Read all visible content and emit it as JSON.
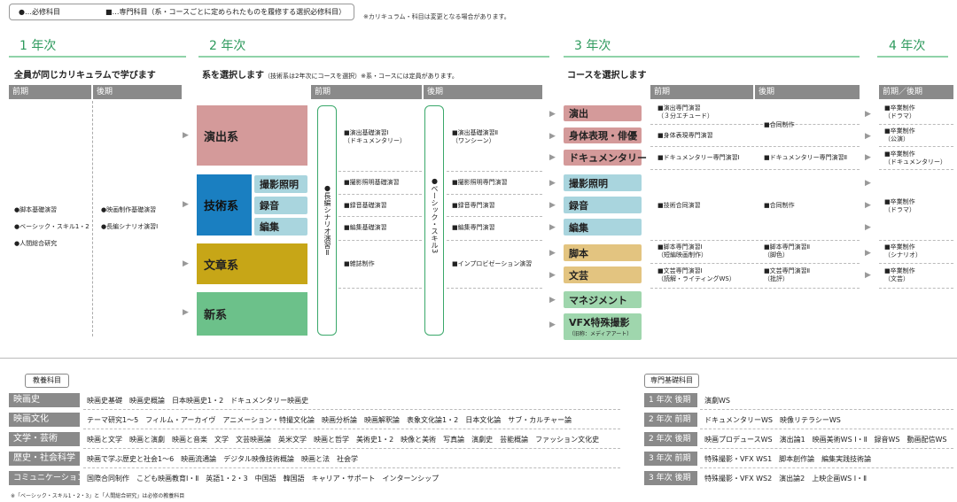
{
  "legend": {
    "required": "●…必修科目",
    "major": "■…専門科目（系・コースごとに定められたものを履修する選択必修科目）"
  },
  "notice": "※カリキュラム・科目は変更となる場合があります。",
  "years": {
    "y1": "1 年次",
    "y2": "2 年次",
    "y3": "3 年次",
    "y4": "4 年次"
  },
  "headings": {
    "h1": "全員が同じカリキュラムで学びます",
    "h2": "系を選択します",
    "h2_note": "（技術系は2年次にコースを選択）※系・コースには定員があります。",
    "h3": "コースを選択します"
  },
  "terms": {
    "first": "前期",
    "second": "後期",
    "both": "前期／後期"
  },
  "y1": {
    "first": [
      "●脚本基礎演習",
      "●ベーシック・スキル1・2",
      "●人間総合研究"
    ],
    "second": [
      "●映画制作基礎演習",
      "●長編シナリオ演習Ⅰ"
    ]
  },
  "departments": {
    "direction": "演出系",
    "tech": "技術系",
    "writing": "文章系",
    "new": "新系"
  },
  "tech_courses": [
    "撮影照明",
    "録音",
    "編集"
  ],
  "bars": {
    "b1": "●長編シナリオ演習Ⅱ",
    "b2": "●ベーシック・スキル3"
  },
  "y2first": [
    "■演出基礎演習Ⅰ",
    "（ドキュメンタリー）",
    "■撮影照明基礎演習",
    "■録音基礎演習",
    "■編集基礎演習",
    "■雑誌制作"
  ],
  "y2second": [
    "■演出基礎演習Ⅱ",
    "（ワンシーン）",
    "■撮影照明専門演習",
    "■録音専門演習",
    "■編集専門演習",
    "■インプロビゼーション演習"
  ],
  "courses": [
    "演出",
    "身体表現・俳優",
    "ドキュメンタリー",
    "撮影照明",
    "録音",
    "編集",
    "脚本",
    "文芸",
    "マネジメント",
    "VFX特殊撮影"
  ],
  "vfx_note": "（旧称：メディアアート）",
  "y3first": [
    "■演出専門演習",
    "（３分エチュード）",
    "■身体表現専門演習",
    "■ドキュメンタリー専門演習Ⅰ",
    "■技術合同演習",
    "■脚本専門演習Ⅰ",
    "（短編映画制作）",
    "■文芸専門演習Ⅰ",
    "（読解・ライティングWS）"
  ],
  "y3second": [
    "■合同制作",
    "■ドキュメンタリー専門演習Ⅱ",
    "■合同制作",
    "■脚本専門演習Ⅱ",
    "（脚色）",
    "■文芸専門演習Ⅱ",
    "（批評）"
  ],
  "y4": [
    "■卒業制作",
    "（ドラマ）",
    "■卒業制作",
    "（公演）",
    "■卒業制作",
    "（ドキュメンタリー）",
    "■卒業制作",
    "（ドラマ）",
    "■卒業制作",
    "（シナリオ）",
    "■卒業制作",
    "（文芸）"
  ],
  "general": {
    "title": "教養科目",
    "rows": [
      {
        "cat": "映画史",
        "items": "映画史基礎　映画史概論　日本映画史1・2　ドキュメンタリー映画史"
      },
      {
        "cat": "映画文化",
        "items": "テーマ研究1～5　フィルム・アーカイヴ　アニメーション・特撮文化論　映画分析論　映画解釈論　表象文化論1・2　日本文化論　サブ・カルチャー論"
      },
      {
        "cat": "文学・芸術",
        "items": "映画と文学　映画と演劇　映画と音楽　文学　文芸映画論　英米文学　映画と哲学　美術史1・2　映像と美術　写真論　演劇史　芸能概論　ファッション文化史"
      },
      {
        "cat": "歴史・社会科学",
        "items": "映画で学ぶ歴史と社会1～6　映画流通論　デジタル映像技術概論　映画と法　社会学"
      },
      {
        "cat": "コミュニケーション",
        "items": "国際合同制作　こども映画教育Ⅰ・Ⅱ　英語1・2・3　中国語　韓国語　キャリア・サポート　インターンシップ"
      }
    ]
  },
  "general_note": "※「ベーシック・スキル1・2・3」と「人間総合研究」は必修の教養科目",
  "basic": {
    "title": "専門基礎科目",
    "rows": [
      {
        "term": "1 年次 後期",
        "items": "演劇WS"
      },
      {
        "term": "2 年次 前期",
        "items": "ドキュメンタリーWS　映像リテラシーWS"
      },
      {
        "term": "2 年次 後期",
        "items": "映画プロデュースWS　演出論1　映画美術WS Ⅰ・Ⅱ　録音WS　動画配信WS"
      },
      {
        "term": "3 年次 前期",
        "items": "特殊撮影・VFX WS1　脚本創作論　編集実践技術論"
      },
      {
        "term": "3 年次 後期",
        "items": "特殊撮影・VFX WS2　演出論2　上映企画WS Ⅰ・Ⅱ"
      }
    ]
  },
  "colors": {
    "direction": "#d49a9a",
    "tech": "#1a7fc1",
    "writing": "#c7a617",
    "new": "#6cc18a",
    "light_blue": "#a9d5de",
    "sand": "#e3c480",
    "green": "#9fd6ad"
  }
}
